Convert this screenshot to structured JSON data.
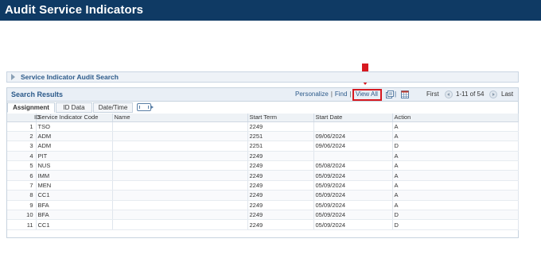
{
  "header": {
    "title": "Audit Service Indicators"
  },
  "collapsible": {
    "label": "Service Indicator Audit Search"
  },
  "grid": {
    "title": "Search Results",
    "personalize": "Personalize",
    "find": "Find",
    "view_all": "View All",
    "nav": {
      "first": "First",
      "range": "1-11 of 54",
      "last": "Last"
    },
    "tabs": [
      {
        "label": "Assignment"
      },
      {
        "label": "ID Data"
      },
      {
        "label": "Date/Time"
      }
    ],
    "columns": [
      "ID",
      "Service Indicator Code",
      "Name",
      "Start Term",
      "Start Date",
      "Action"
    ],
    "rows": [
      {
        "id": "1",
        "code": "TSO",
        "name": "",
        "term": "2249",
        "date": "",
        "action": "A"
      },
      {
        "id": "2",
        "code": "ADM",
        "name": "",
        "term": "2251",
        "date": "09/06/2024",
        "action": "A"
      },
      {
        "id": "3",
        "code": "ADM",
        "name": "",
        "term": "2251",
        "date": "09/06/2024",
        "action": "D"
      },
      {
        "id": "4",
        "code": "PIT",
        "name": "",
        "term": "2249",
        "date": "",
        "action": "A"
      },
      {
        "id": "5",
        "code": "NUS",
        "name": "",
        "term": "2249",
        "date": "05/08/2024",
        "action": "A"
      },
      {
        "id": "6",
        "code": "IMM",
        "name": "",
        "term": "2249",
        "date": "05/09/2024",
        "action": "A"
      },
      {
        "id": "7",
        "code": "MEN",
        "name": "",
        "term": "2249",
        "date": "05/09/2024",
        "action": "A"
      },
      {
        "id": "8",
        "code": "CC1",
        "name": "",
        "term": "2249",
        "date": "05/09/2024",
        "action": "A"
      },
      {
        "id": "9",
        "code": "BFA",
        "name": "",
        "term": "2249",
        "date": "05/09/2024",
        "action": "A"
      },
      {
        "id": "10",
        "code": "BFA",
        "name": "",
        "term": "2249",
        "date": "05/09/2024",
        "action": "D"
      },
      {
        "id": "11",
        "code": "CC1",
        "name": "",
        "term": "2249",
        "date": "05/09/2024",
        "action": "D"
      }
    ]
  },
  "icons": {
    "collapse": "triangle-right-icon",
    "zoom": "zoom-grid-icon",
    "download": "download-excel-icon",
    "show_all_columns": "show-all-columns-icon",
    "prev": "previous-icon",
    "next": "next-icon",
    "callout": "down-arrow-icon"
  },
  "colors": {
    "header_bg": "#0f3a64",
    "link": "#2c5a8a",
    "highlight": "#d71920"
  }
}
